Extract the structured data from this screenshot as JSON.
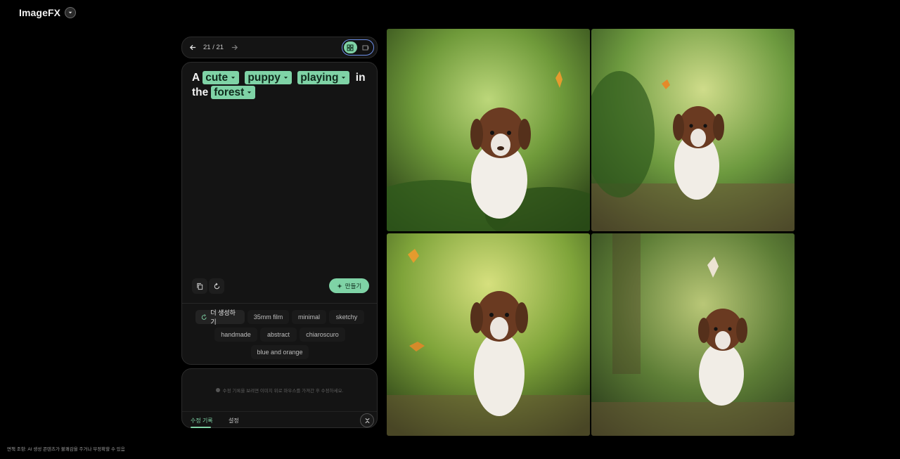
{
  "app": {
    "title": "ImageFX"
  },
  "nav": {
    "pager": "21 / 21"
  },
  "prompt": {
    "leading_word": "A",
    "chips": [
      "cute",
      "puppy",
      "playing"
    ],
    "middle_word": "in",
    "trailing_word": "the",
    "last_chip": "forest"
  },
  "actions": {
    "make_label": "만들기"
  },
  "styles": {
    "more_label": "더 생성하기",
    "items": [
      "35mm film",
      "minimal",
      "sketchy",
      "handmade",
      "abstract",
      "chiaroscuro",
      "blue and orange"
    ]
  },
  "history": {
    "hint": "수정 기록을 보려면 이미지 위로 마우스를 가져간 후 수정하세요.",
    "tabs": [
      "수정 기록",
      "설정"
    ]
  },
  "footer": {
    "disclaimer": "면책 조항: AI 생성 콘텐츠가 불쾌감을 주거나 부정확할 수 있음"
  },
  "images": [
    {
      "alt": "puppy with butterfly in forest 1"
    },
    {
      "alt": "puppy with butterfly in forest 2"
    },
    {
      "alt": "puppy with butterfly in forest 3"
    },
    {
      "alt": "puppy with butterfly in forest 4"
    }
  ],
  "colors": {
    "accent": "#7fd3a6",
    "toggle_border": "#6d8fe8",
    "panel": "#141414"
  }
}
